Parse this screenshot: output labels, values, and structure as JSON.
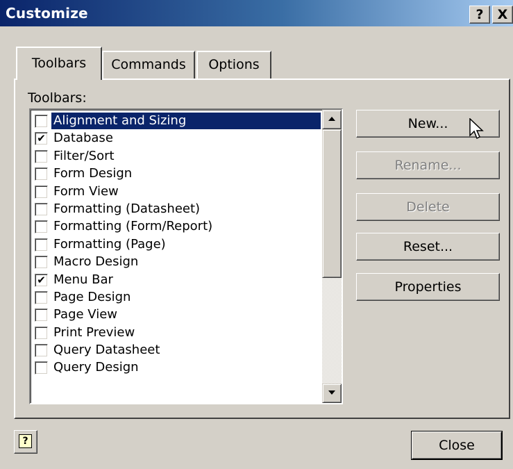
{
  "window": {
    "title": "Customize"
  },
  "titlebar": {
    "help_label": "?",
    "close_label": "X"
  },
  "tabs": [
    {
      "label": "Toolbars"
    },
    {
      "label": "Commands"
    },
    {
      "label": "Options"
    }
  ],
  "toolbars_label": "Toolbars:",
  "toolbars": [
    {
      "label": "Alignment and Sizing",
      "checked": false,
      "selected": true
    },
    {
      "label": "Database",
      "checked": true
    },
    {
      "label": "Filter/Sort",
      "checked": false
    },
    {
      "label": "Form Design",
      "checked": false
    },
    {
      "label": "Form View",
      "checked": false
    },
    {
      "label": "Formatting (Datasheet)",
      "checked": false
    },
    {
      "label": "Formatting (Form/Report)",
      "checked": false
    },
    {
      "label": "Formatting (Page)",
      "checked": false
    },
    {
      "label": "Macro Design",
      "checked": false
    },
    {
      "label": "Menu Bar",
      "checked": true
    },
    {
      "label": "Page Design",
      "checked": false
    },
    {
      "label": "Page View",
      "checked": false
    },
    {
      "label": "Print Preview",
      "checked": false
    },
    {
      "label": "Query Datasheet",
      "checked": false
    },
    {
      "label": "Query Design",
      "checked": false
    }
  ],
  "buttons": {
    "new": "New...",
    "rename": "Rename...",
    "delete": "Delete",
    "reset": "Reset...",
    "properties": "Properties",
    "close": "Close"
  },
  "colors": {
    "face": "#d4d0c8",
    "selection": "#0a246a",
    "title_start": "#0a246a",
    "title_end": "#a6caf0",
    "disabled_text": "#808080"
  },
  "icons": {
    "help_button": "help-question-icon",
    "cursor": "mouse-pointer-icon"
  }
}
